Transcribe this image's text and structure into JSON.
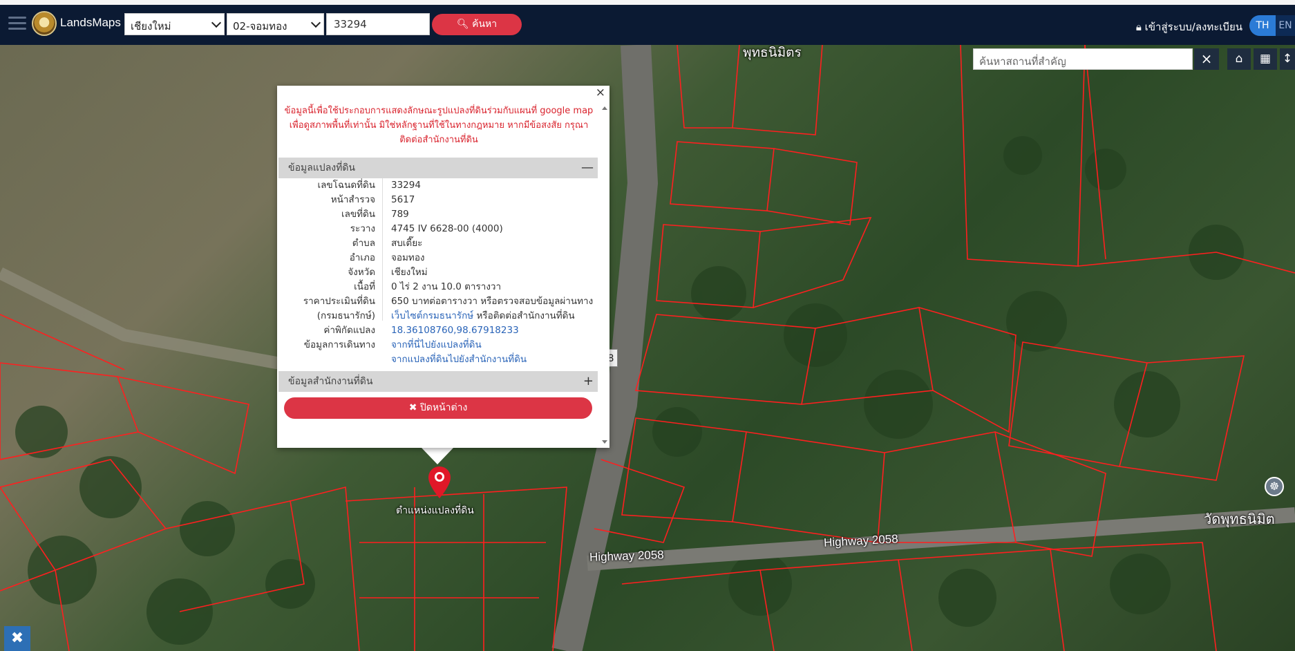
{
  "navbar": {
    "brand": "LandsMaps",
    "province_select": "เชียงใหม่",
    "district_select": "02-จอมทอง",
    "parcel_number": "33294",
    "search_label": "ค้นหา",
    "login_label": "เข้าสู่ระบบ/ลงทะเบียน",
    "lang_th": "TH",
    "lang_en": "EN"
  },
  "map": {
    "place_search_placeholder": "ค้นหาสถานที่สำคัญ",
    "area_label": "พุทธนิมิตร",
    "road_label_1": "Highway 2058",
    "road_label_2": "Highway 2058",
    "poi_label": "วัดพุทธนิมิต",
    "pin_label": "ตำแหน่งแปลงที่ดิน",
    "sign_text": "8"
  },
  "popup": {
    "close_glyph": "×",
    "disclaimer_1": "ข้อมูลนี้เพื่อใช้ประกอบการแสดงลักษณะรูปแปลงที่ดินร่วมกับแผนที่ google map",
    "disclaimer_2": "เพื่อดูสภาพพื้นที่เท่านั้น มิใช่หลักฐานที่ใช้ในทางกฎหมาย หากมีข้อสงสัย กรุณา",
    "disclaimer_3": "ติดต่อสำนักงานที่ดิน",
    "section_parcel": "ข้อมูลแปลงที่ดิน",
    "section_office": "ข้อมูลสำนักงานที่ดิน",
    "close_window_label": "ปิดหน้าต่าง",
    "rows": [
      {
        "label": "เลขโฉนดที่ดิน",
        "value": "33294"
      },
      {
        "label": "หน้าสำรวจ",
        "value": "5617"
      },
      {
        "label": "เลขที่ดิน",
        "value": "789"
      },
      {
        "label": "ระวาง",
        "value": "4745 IV 6628-00 (4000)"
      },
      {
        "label": "ตำบล",
        "value": "สบเตี๊ยะ"
      },
      {
        "label": "อำเภอ",
        "value": "จอมทอง"
      },
      {
        "label": "จังหวัด",
        "value": "เชียงใหม่"
      },
      {
        "label": "เนื้อที่",
        "value": "0 ไร่ 2 งาน 10.0 ตารางวา"
      },
      {
        "label": "ราคาประเมินที่ดิน",
        "value": "650 บาทต่อตารางวา หรือตรวจสอบข้อมูลผ่านทาง"
      },
      {
        "label": "(กรมธนารักษ์)",
        "value": "เว็บไซต์กรมธนารักษ์",
        "value_suffix": " หรือติดต่อสำนักงานที่ดิน"
      },
      {
        "label": "ค่าพิกัดแปลง",
        "value": "18.36108760,98.67918233"
      },
      {
        "label": "ข้อมูลการเดินทาง",
        "value": "จากที่นี่ไปยังแปลงที่ดิน"
      },
      {
        "label": "",
        "value": "จากแปลงที่ดินไปยังสำนักงานที่ดิน"
      }
    ]
  }
}
